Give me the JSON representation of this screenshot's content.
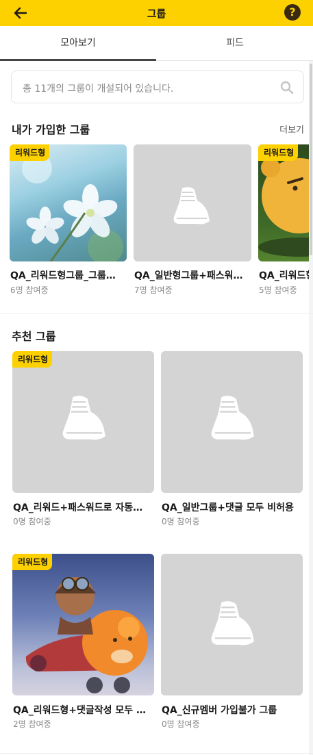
{
  "header": {
    "title": "그룹",
    "help_label": "?"
  },
  "tabs": [
    {
      "label": "모아보기",
      "active": true
    },
    {
      "label": "피드",
      "active": false
    }
  ],
  "search": {
    "placeholder": "총 11개의 그룹이 개설되어 있습니다."
  },
  "my_groups": {
    "title": "내가 가입한 그룹",
    "more_label": "더보기",
    "items": [
      {
        "badge": "리워드형",
        "name": "QA_리워드형그룹_그룹…",
        "members": "6명 참여중",
        "thumb": "flower-photo"
      },
      {
        "badge": "",
        "name": "QA_일반형그룹+패스워…",
        "members": "7명 참여중",
        "thumb": "sneaker-placeholder"
      },
      {
        "badge": "리워드형",
        "name": "QA_리워드형",
        "members": "5명 참여중",
        "thumb": "ryan-character"
      }
    ]
  },
  "recommended": {
    "title": "추천 그룹",
    "items": [
      {
        "badge": "리워드형",
        "name": "QA_리워드+패스워드로 자동…",
        "members": "0명 참여중",
        "thumb": "sneaker-placeholder"
      },
      {
        "badge": "",
        "name": "QA_일반그룹+댓글 모두 비허용",
        "members": "0명 참여중",
        "thumb": "sneaker-placeholder"
      },
      {
        "badge": "리워드형",
        "name": "QA_리워드형+댓글작성 모두 …",
        "members": "2명 참여중",
        "thumb": "ryan-pilot-illustration"
      },
      {
        "badge": "",
        "name": "QA_신규멤버 가입불가 그룹",
        "members": "0명 참여중",
        "thumb": "sneaker-placeholder"
      }
    ]
  },
  "colors": {
    "accent": "#fdd000",
    "placeholder_bg": "#d4d4d4"
  }
}
